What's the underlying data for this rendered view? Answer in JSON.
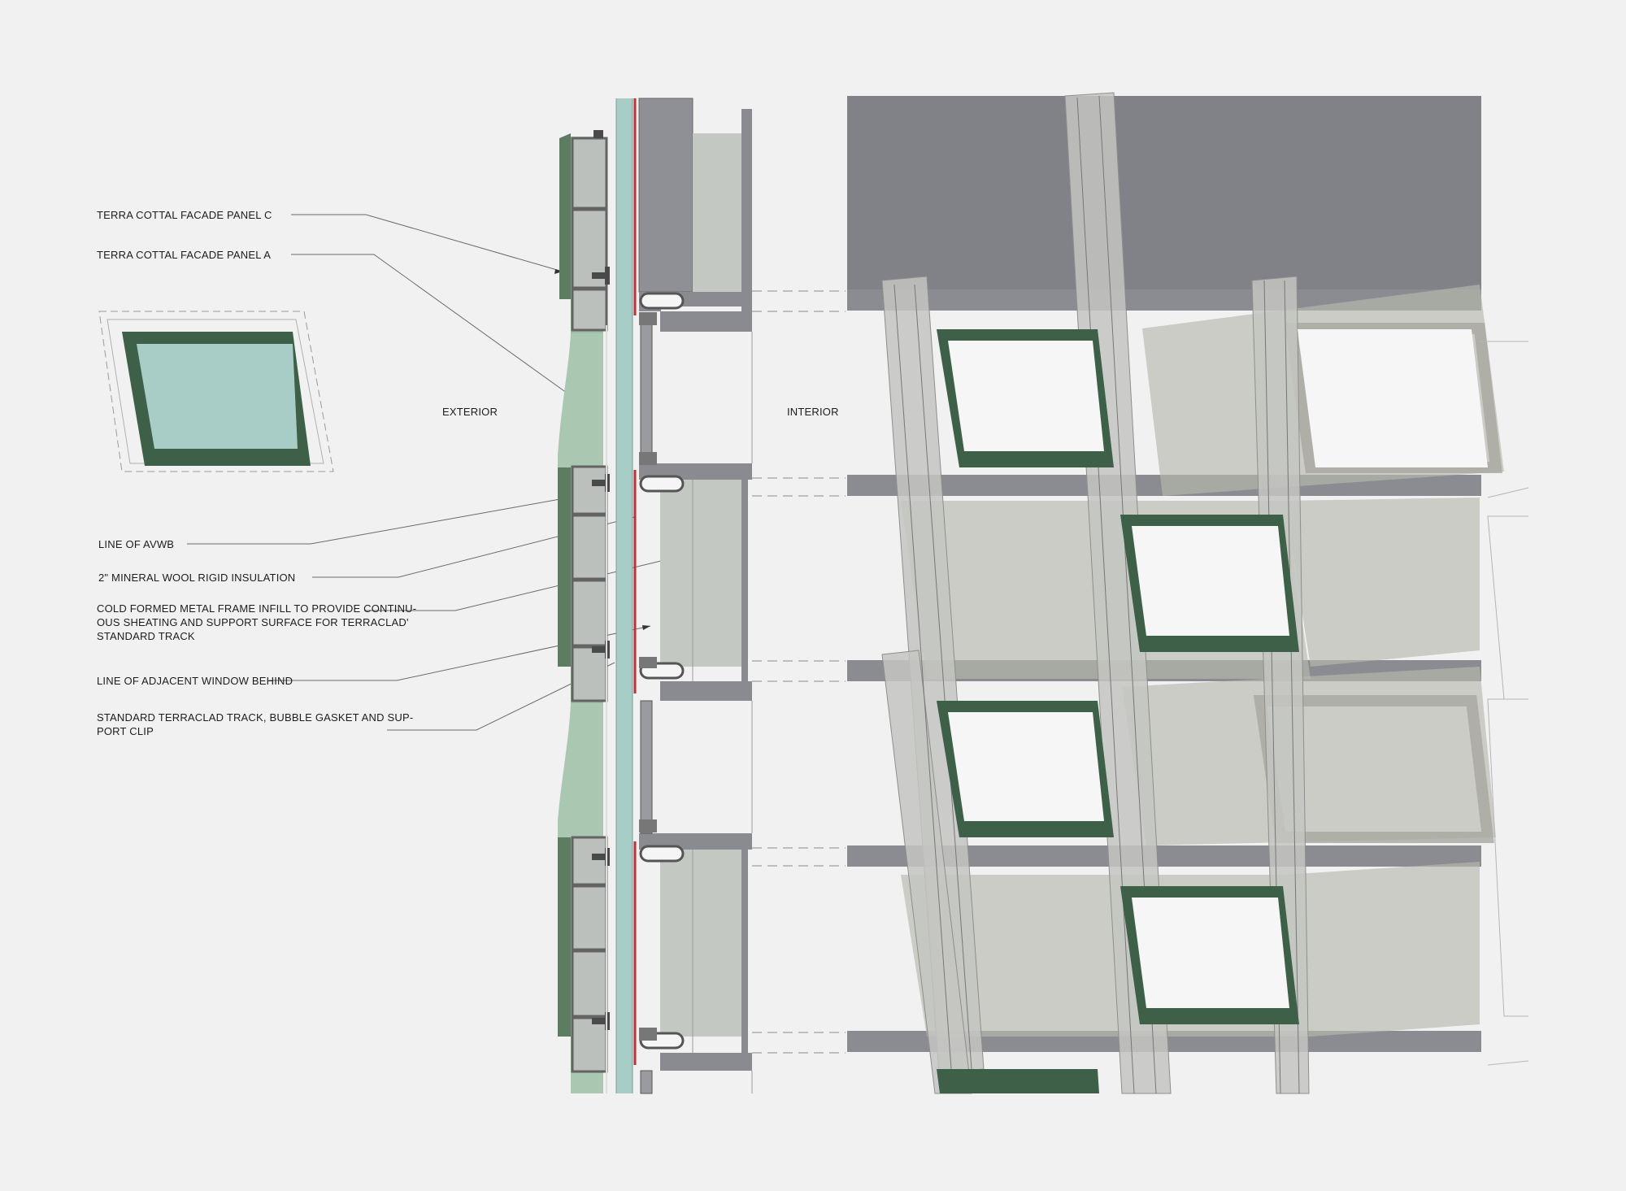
{
  "callouts": {
    "panel_c": "TERRA COTTAL FACADE PANEL C",
    "panel_a": "TERRA COTTAL FACADE PANEL A",
    "avwb": "LINE OF AVWB",
    "insulation": "2\" MINERAL WOOL RIGID INSULATION",
    "frame_infill": [
      "COLD FORMED METAL FRAME INFILL TO PROVIDE CONTINU-",
      "OUS SHEATING AND SUPPORT SURFACE FOR TERRACLAD'",
      "STANDARD TRACK"
    ],
    "adjacent_window": "LINE OF ADJACENT WINDOW BEHIND",
    "track": [
      "STANDARD TERRACLAD TRACK, BUBBLE GASKET AND SUP-",
      "PORT CLIP"
    ]
  },
  "zones": {
    "exterior": "EXTERIOR",
    "interior": "INTERIOR"
  },
  "colors": {
    "background": "#f1f1f1",
    "terracotta_green": "#3f6048",
    "panel_light_green": "#a9c7b1",
    "glass": "#a8ccc6",
    "slab_gray": "#82838a",
    "component_gray": "#bfc3be",
    "avwb_red": "#c0303a",
    "leader": "#666666"
  }
}
